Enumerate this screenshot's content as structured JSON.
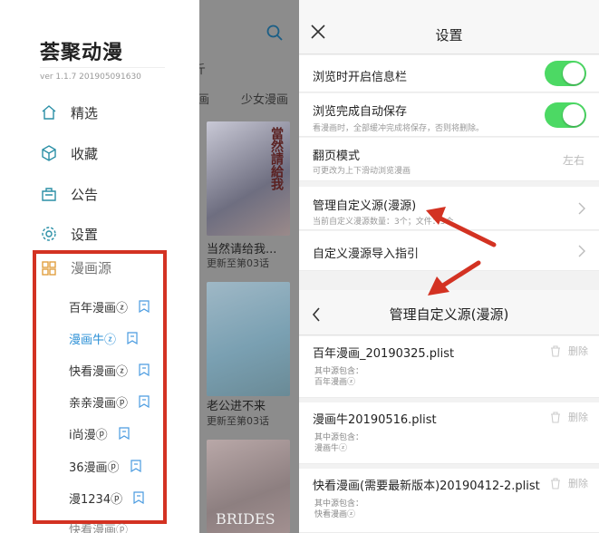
{
  "drawer": {
    "app_name": "荟聚动漫",
    "version": "ver 1.1.7  201905091630",
    "nav": [
      {
        "label": "精选",
        "icon": "home-icon"
      },
      {
        "label": "收藏",
        "icon": "box-icon"
      },
      {
        "label": "公告",
        "icon": "notice-icon"
      },
      {
        "label": "设置",
        "icon": "gear-icon"
      }
    ],
    "sources_header": "漫画源",
    "sources": [
      {
        "label": "百年漫画ⓩ",
        "active": false
      },
      {
        "label": "漫画牛ⓩ",
        "active": true
      },
      {
        "label": "快看漫画ⓩ",
        "active": false
      },
      {
        "label": "亲亲漫画ⓟ",
        "active": false
      },
      {
        "label": "i尚漫ⓟ",
        "active": false
      },
      {
        "label": "36漫画ⓟ",
        "active": false
      },
      {
        "label": "漫1234ⓟ",
        "active": false
      }
    ],
    "sources_cut": "快看漫画ⓟ"
  },
  "mid": {
    "tab_fragment": "斤",
    "tab1": "画",
    "tab2": "少女漫画",
    "cover1_text": "當然請給我",
    "cover3_text": "BRIDES",
    "items": [
      {
        "title": "当然请给我...",
        "update": "更新至第03话"
      },
      {
        "title": "老公进不来",
        "update": "更新至第03话"
      }
    ]
  },
  "settings": {
    "title": "设置",
    "rows": {
      "info_bar": {
        "title": "浏览时开启信息栏",
        "on": true
      },
      "auto_save": {
        "title": "浏览完成自动保存",
        "sub": "看漫画时，全部缓冲完成将保存，否则将删除。",
        "on": true
      },
      "page_mode": {
        "title": "翻页模式",
        "sub": "可更改为上下滑动浏览漫画",
        "value": "左右"
      },
      "manage": {
        "title": "管理自定义源(漫源)",
        "sub": "当前自定义漫源数量：3个；文件：3个"
      },
      "guide": {
        "title": "自定义漫源导入指引"
      }
    }
  },
  "manage_page": {
    "title": "管理自定义源(漫源)",
    "delete_label": "删除",
    "contains_label": "其中源包含：",
    "files": [
      {
        "name": "百年漫画_20190325.plist",
        "contains": "百年漫画ⓩ"
      },
      {
        "name": "漫画牛20190516.plist",
        "contains": "漫画牛ⓩ"
      },
      {
        "name": "快看漫画(需要最新版本)20190412-2.plist",
        "contains": "快看漫画ⓩ"
      }
    ]
  },
  "colors": {
    "highlight_box": "#d33222",
    "toggle_on": "#4cd964",
    "active_source": "#2a8fd6",
    "arrow": "#d33222"
  }
}
